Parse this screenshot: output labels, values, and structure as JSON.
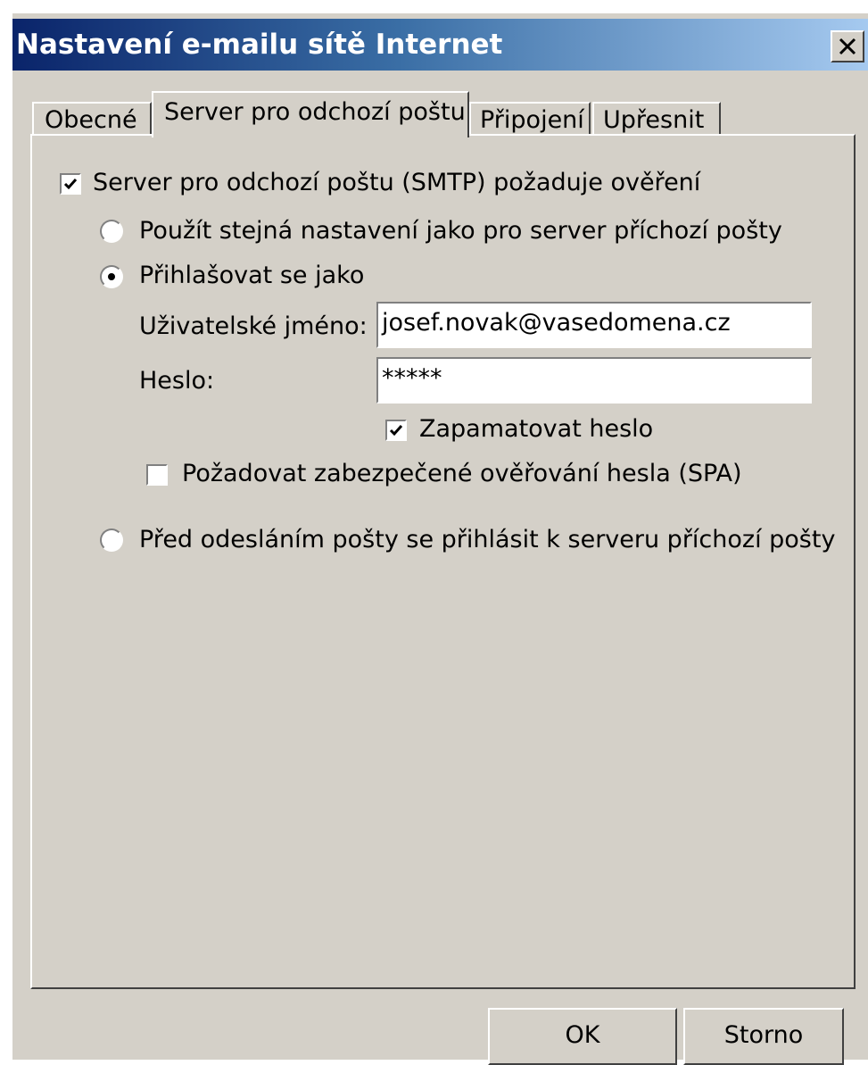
{
  "window": {
    "title": "Nastavení e-mailu sítě Internet",
    "close_symbol": "X"
  },
  "tabs": [
    {
      "label": "Obecné",
      "active": false
    },
    {
      "label": "Server pro odchozí poštu",
      "active": true
    },
    {
      "label": "Připojení",
      "active": false
    },
    {
      "label": "Upřesnit",
      "active": false
    }
  ],
  "smtp_auth": {
    "label": "Server pro odchozí poštu (SMTP) požaduje ověření",
    "checked": true
  },
  "options": {
    "same_settings": {
      "label": "Použít stejná nastavení jako pro server příchozí pošty",
      "selected": false
    },
    "login_as": {
      "label": "Přihlašovat se jako",
      "selected": true
    },
    "login_before_send": {
      "label": "Před odesláním pošty se přihlásit k serveru příchozí pošty",
      "selected": false
    }
  },
  "fields": {
    "username_label": "Uživatelské jméno:",
    "username_value": "josef.novak@vasedomena.cz",
    "password_label": "Heslo:",
    "password_value": "*****"
  },
  "remember_password": {
    "label": "Zapamatovat heslo",
    "checked": true
  },
  "require_spa": {
    "label": "Požadovat zabezpečené ověřování hesla (SPA)",
    "checked": false
  },
  "buttons": {
    "ok": "OK",
    "cancel": "Storno"
  },
  "colors": {
    "dialog_face": "#d4d0c8",
    "title_gradient_start": "#0a246a",
    "title_gradient_end": "#a6caf0",
    "title_text": "#ffffff"
  }
}
